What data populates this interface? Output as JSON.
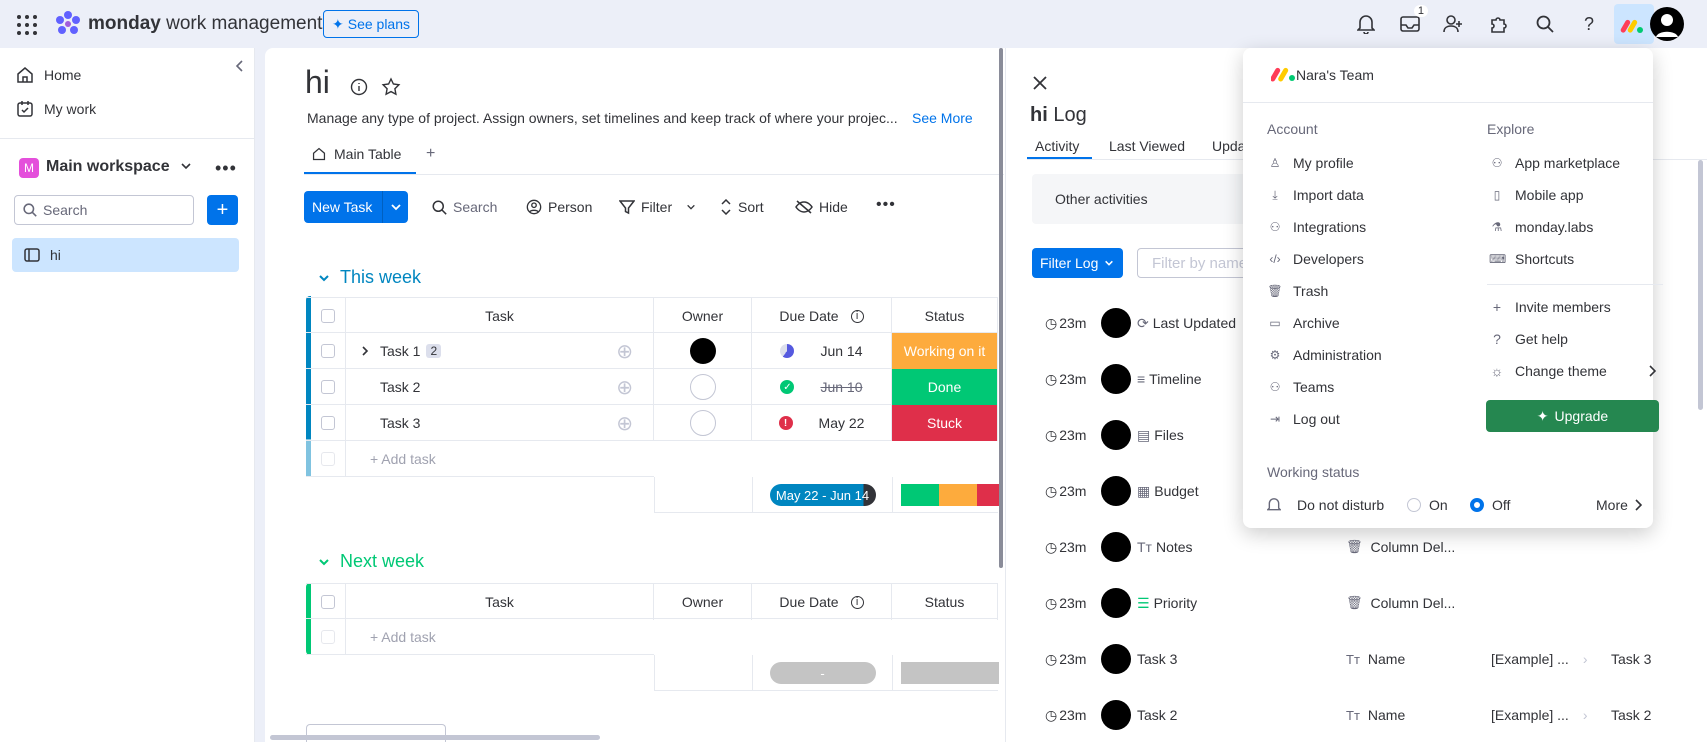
{
  "topbar": {
    "brand_bold": "monday",
    "brand_rest": " work management",
    "see_plans": "See plans",
    "inbox_badge": "1",
    "accent": "#0073ea"
  },
  "sidebar": {
    "home": "Home",
    "my_work": "My work",
    "workspace_initial": "M",
    "workspace_name": "Main workspace",
    "search_placeholder": "Search",
    "board": "hi"
  },
  "board": {
    "title": "hi",
    "description": "Manage any type of project. Assign owners, set timelines and keep track of where your projec...",
    "see_more": "See More",
    "tab_main": "Main Table",
    "new_task": "New Task",
    "toolbar": {
      "search": "Search",
      "person": "Person",
      "filter": "Filter",
      "sort": "Sort",
      "hide": "Hide"
    },
    "columns": {
      "task": "Task",
      "owner": "Owner",
      "due_date": "Due Date",
      "status": "Status"
    },
    "groups": [
      {
        "title": "This week",
        "color": "#0086c0",
        "rows": [
          {
            "task": "Task 1",
            "subitems": "2",
            "due": "Jun 14",
            "status": "Working on it",
            "status_color": "#fdab3d"
          },
          {
            "task": "Task 2",
            "due": "Jun 10",
            "status": "Done",
            "status_color": "#00c875"
          },
          {
            "task": "Task 3",
            "due": "May 22",
            "status": "Stuck",
            "status_color": "#df2f4a"
          }
        ],
        "add_task": "+ Add task",
        "timeline_summary": "May 22 - Jun 14"
      },
      {
        "title": "Next week",
        "color": "#00c875",
        "add_task": "+ Add task",
        "timeline_summary": "-"
      }
    ]
  },
  "log": {
    "title_bold": "hi",
    "title_rest": "Log",
    "tabs": [
      "Activity",
      "Last Viewed",
      "Upda"
    ],
    "other_activities": "Other activities",
    "filter_log": "Filter Log",
    "filter_placeholder": "Filter by name",
    "rows": [
      {
        "time": "23m",
        "label": "Last Updated",
        "icon": "refresh-icon",
        "extra": ""
      },
      {
        "time": "23m",
        "label": "Timeline",
        "icon": "timeline-icon",
        "extra": ""
      },
      {
        "time": "23m",
        "label": "Files",
        "icon": "file-icon",
        "extra": ""
      },
      {
        "time": "23m",
        "label": "Budget",
        "icon": "budget-icon",
        "extra": ""
      },
      {
        "time": "23m",
        "label": "Notes",
        "icon": "text-icon",
        "extra": "Column Del..."
      },
      {
        "time": "23m",
        "label": "Priority",
        "icon": "priority-icon",
        "extra": "Column Del..."
      },
      {
        "time": "23m",
        "label": "Task 3",
        "icon": "",
        "extra": "Name",
        "old": "[Example] ...",
        "new": "Task 3"
      },
      {
        "time": "23m",
        "label": "Task 2",
        "icon": "",
        "extra": "Name",
        "old": "[Example] ...",
        "new": "Task 2"
      }
    ]
  },
  "menu": {
    "team": "Nara's Team",
    "account_title": "Account",
    "explore_title": "Explore",
    "account_items": [
      "My profile",
      "Import data",
      "Integrations",
      "Developers",
      "Trash",
      "Archive",
      "Administration",
      "Teams",
      "Log out"
    ],
    "explore_items": [
      "App marketplace",
      "Mobile app",
      "monday.labs",
      "Shortcuts"
    ],
    "explore_items_2": [
      "Invite members",
      "Get help",
      "Change theme"
    ],
    "upgrade": "Upgrade",
    "working_status": "Working status",
    "do_not_disturb": "Do not disturb",
    "on": "On",
    "off": "Off",
    "more": "More",
    "upgrade_color": "#258750"
  }
}
